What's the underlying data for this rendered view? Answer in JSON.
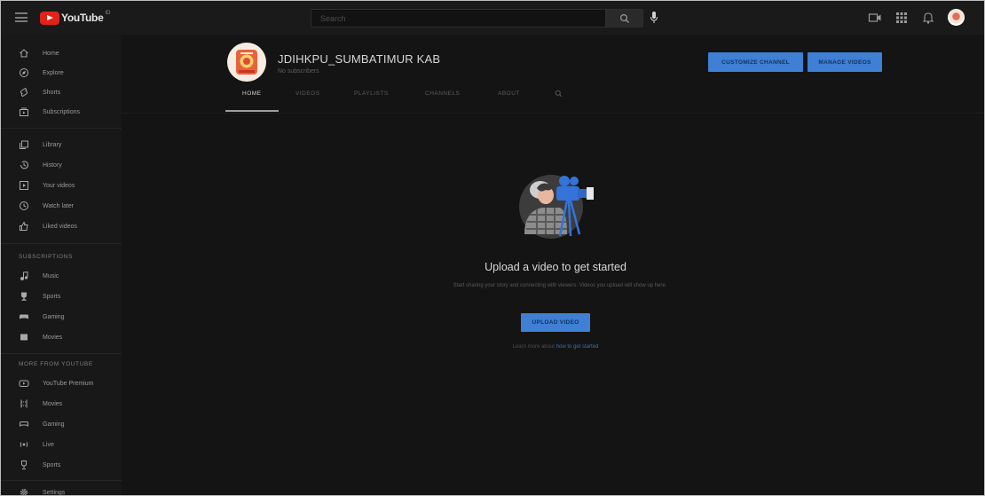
{
  "topbar": {
    "logo_text": "YouTube",
    "logo_superscript": "ID",
    "search_placeholder": "Search"
  },
  "sidebar": {
    "main": [
      {
        "label": "Home",
        "icon": "home-icon"
      },
      {
        "label": "Explore",
        "icon": "compass-icon"
      },
      {
        "label": "Shorts",
        "icon": "shorts-icon"
      },
      {
        "label": "Subscriptions",
        "icon": "subscriptions-icon"
      }
    ],
    "library": [
      {
        "label": "Library",
        "icon": "library-icon"
      },
      {
        "label": "History",
        "icon": "history-icon"
      },
      {
        "label": "Your videos",
        "icon": "your-videos-icon"
      },
      {
        "label": "Watch later",
        "icon": "clock-icon"
      },
      {
        "label": "Liked videos",
        "icon": "thumbs-up-icon"
      }
    ],
    "subscriptions_heading": "SUBSCRIPTIONS",
    "subscriptions": [
      {
        "label": "Music",
        "icon": "music-icon"
      },
      {
        "label": "Sports",
        "icon": "sports-icon"
      },
      {
        "label": "Gaming",
        "icon": "gaming-icon"
      },
      {
        "label": "Movies",
        "icon": "movies-icon"
      }
    ],
    "more_heading": "MORE FROM YOUTUBE",
    "more": [
      {
        "label": "YouTube Premium",
        "icon": "premium-icon"
      },
      {
        "label": "Movies",
        "icon": "film-icon"
      },
      {
        "label": "Gaming",
        "icon": "controller-icon"
      },
      {
        "label": "Live",
        "icon": "live-icon"
      },
      {
        "label": "Sports",
        "icon": "trophy-icon"
      }
    ],
    "settings": {
      "label": "Settings",
      "icon": "gear-icon"
    }
  },
  "channel": {
    "name": "JDIHKPU_SUMBATIMUR KAB",
    "subscribers": "No subscribers",
    "customize_label": "CUSTOMIZE CHANNEL",
    "manage_label": "MANAGE VIDEOS",
    "tabs": [
      "HOME",
      "VIDEOS",
      "PLAYLISTS",
      "CHANNELS",
      "ABOUT"
    ]
  },
  "empty_state": {
    "title": "Upload a video to get started",
    "description": "Start sharing your story and connecting with viewers. Videos you upload will show up here.",
    "upload_label": "UPLOAD VIDEO",
    "learn_prefix": "Learn more about ",
    "learn_link": "how to get started"
  },
  "colors": {
    "background": "#141414",
    "sidebar": "#181818",
    "accent_blue": "#3f7fd4",
    "logo_red": "#e2231a"
  }
}
